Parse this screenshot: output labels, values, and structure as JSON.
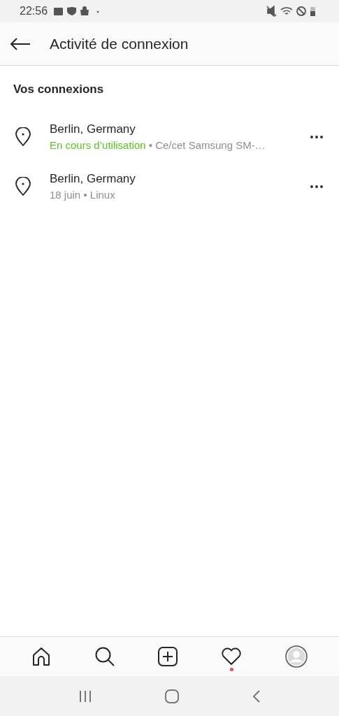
{
  "status_bar": {
    "time": "22:56"
  },
  "header": {
    "title": "Activité de connexion"
  },
  "section_title": "Vos connexions",
  "sessions": [
    {
      "location": "Berlin, Germany",
      "status": "En cours d’utilisation",
      "active": true,
      "detail": "• Ce/cet Samsung SM-…"
    },
    {
      "location": "Berlin, Germany",
      "status": "18 juin",
      "active": false,
      "detail": "• Linux"
    }
  ],
  "bottom_nav": {
    "activity_notification": true
  }
}
